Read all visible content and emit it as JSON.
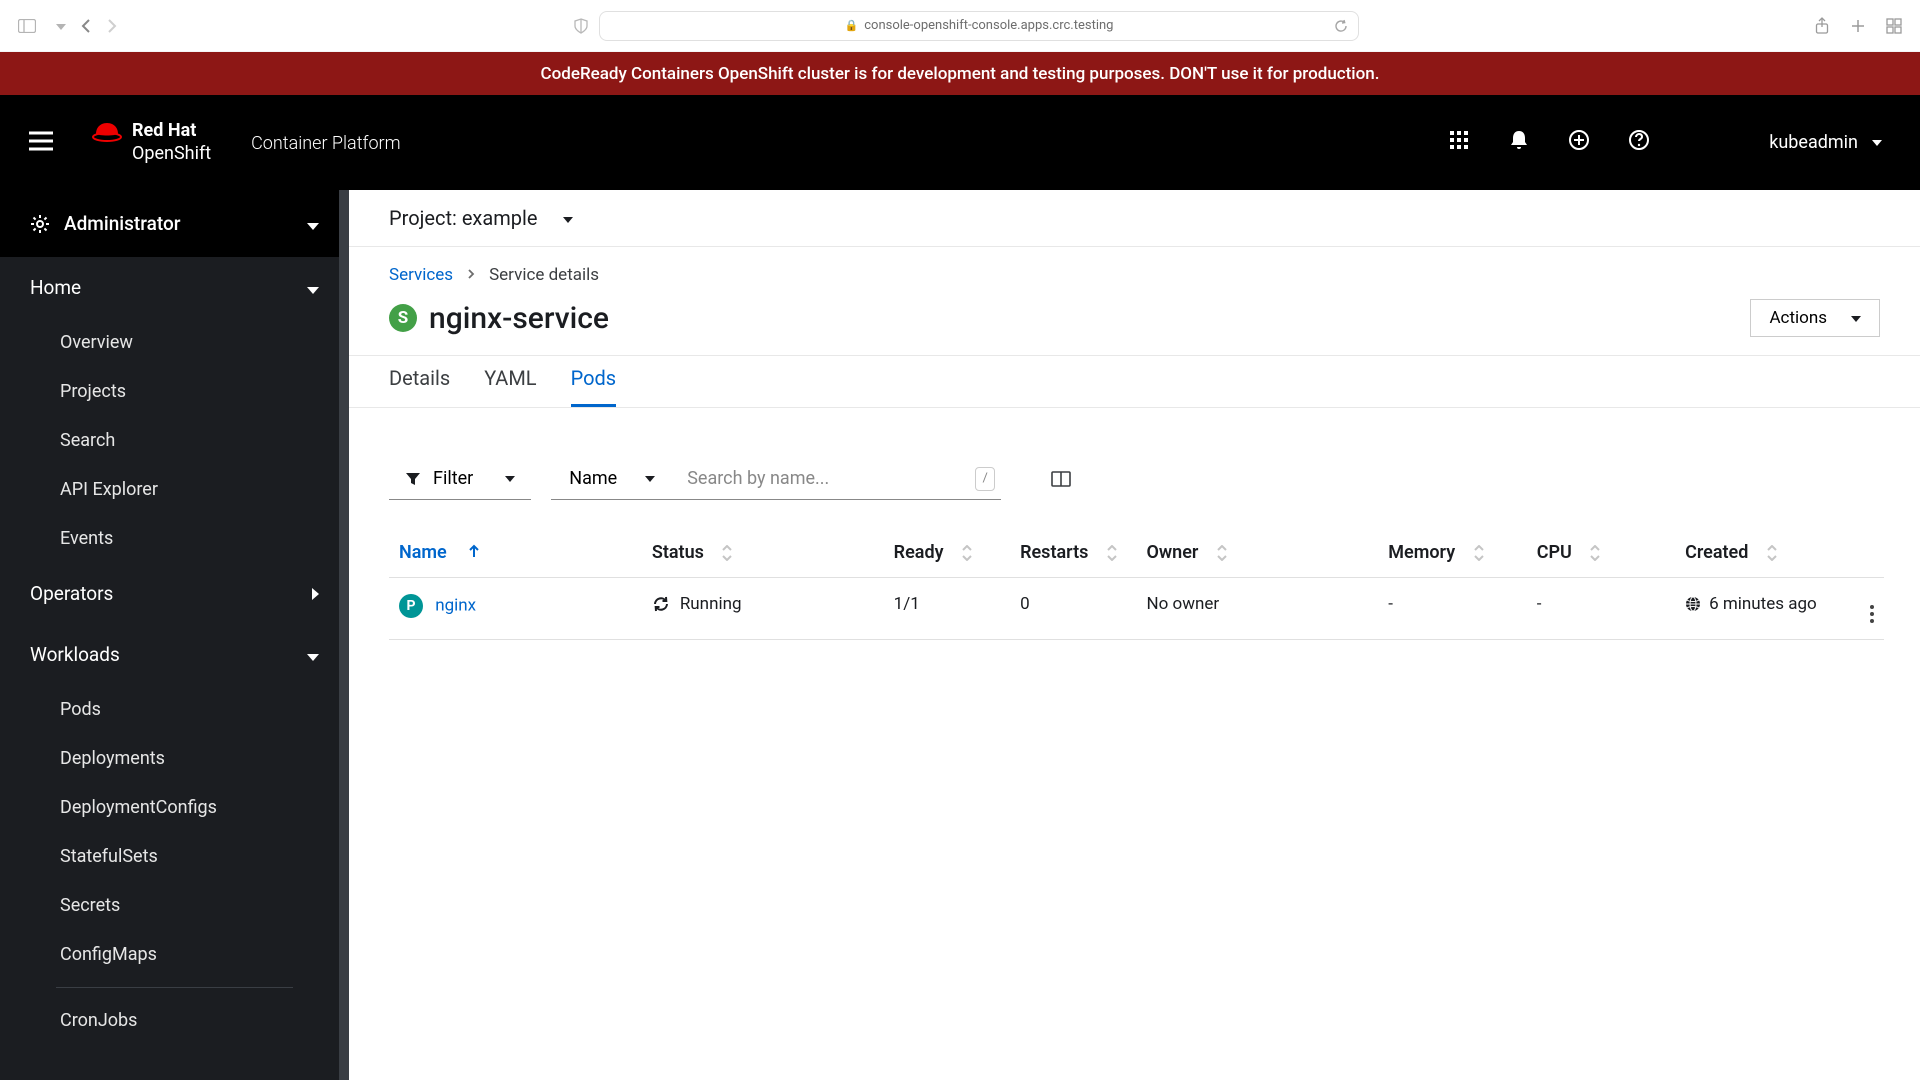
{
  "browser": {
    "url": "console-openshift-console.apps.crc.testing"
  },
  "banner": "CodeReady Containers OpenShift cluster is for development and testing purposes. DON'T use it for production.",
  "brand": {
    "line1": "Red Hat",
    "line2": "OpenShift",
    "line3": "Container Platform"
  },
  "user": "kubeadmin",
  "sidebar": {
    "perspective": "Administrator",
    "sections": [
      {
        "label": "Home",
        "expanded": true,
        "items": [
          "Overview",
          "Projects",
          "Search",
          "API Explorer",
          "Events"
        ]
      },
      {
        "label": "Operators",
        "expanded": false,
        "items": []
      },
      {
        "label": "Workloads",
        "expanded": true,
        "items": [
          "Pods",
          "Deployments",
          "DeploymentConfigs",
          "StatefulSets",
          "Secrets",
          "ConfigMaps"
        ],
        "items2": [
          "CronJobs"
        ]
      }
    ]
  },
  "project": {
    "label": "Project:",
    "value": "example"
  },
  "breadcrumb": {
    "parent": "Services",
    "current": "Service details"
  },
  "page": {
    "badge": "S",
    "title": "nginx-service",
    "actions": "Actions"
  },
  "tabs": [
    "Details",
    "YAML",
    "Pods"
  ],
  "active_tab": 2,
  "toolbar": {
    "filter": "Filter",
    "scope": "Name",
    "search_placeholder": "Search by name..."
  },
  "table": {
    "columns": [
      "Name",
      "Status",
      "Ready",
      "Restarts",
      "Owner",
      "Memory",
      "CPU",
      "Created"
    ],
    "sort_col": 0,
    "rows": [
      {
        "name": "nginx",
        "status": "Running",
        "ready": "1/1",
        "restarts": "0",
        "owner": "No owner",
        "memory": "-",
        "cpu": "-",
        "created": "6 minutes ago"
      }
    ]
  }
}
